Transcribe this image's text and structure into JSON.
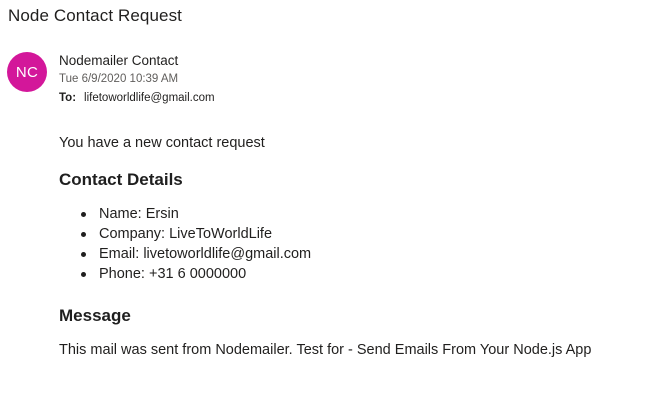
{
  "email": {
    "subject": "Node Contact Request",
    "avatar_initials": "NC",
    "avatar_color": "#d3179a",
    "sender_name": "Nodemailer Contact",
    "sent_date": "Tue 6/9/2020 10:39 AM",
    "to_label": "To:",
    "to_address": "lifetoworldlife@gmail.com"
  },
  "body": {
    "intro": "You have a new contact request",
    "details_heading": "Contact Details",
    "details": [
      "Name: Ersin",
      "Company: LiveToWorldLife",
      "Email: livetoworldlife@gmail.com",
      "Phone: +31 6 0000000"
    ],
    "message_heading": "Message",
    "message_text": "This mail was sent from Nodemailer. Test for - Send Emails From Your Node.js App"
  }
}
